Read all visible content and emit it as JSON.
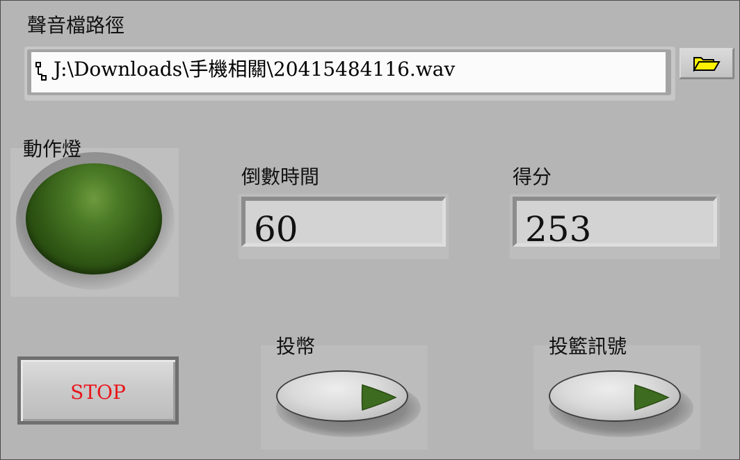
{
  "path_control": {
    "label": "聲音檔路徑",
    "value": "J:\\Downloads\\手機相關\\20415484116.wav",
    "browse_icon": "folder-open-icon"
  },
  "led": {
    "label": "動作燈",
    "state": "off",
    "color_on": "#4aa52e",
    "color_off": "#2f5614"
  },
  "countdown": {
    "label": "倒數時間",
    "value": "60"
  },
  "score": {
    "label": "得分",
    "value": "253"
  },
  "stop_button": {
    "label": "STOP",
    "label_color": "#e8161b"
  },
  "coin_button": {
    "label": "投幣",
    "indicator_icon": "play-triangle-icon"
  },
  "shot_signal_button": {
    "label": "投籃訊號",
    "indicator_icon": "play-triangle-icon"
  },
  "colors": {
    "panel_bg": "#b5b5b5",
    "indicator_green": "#3d6b1f"
  }
}
